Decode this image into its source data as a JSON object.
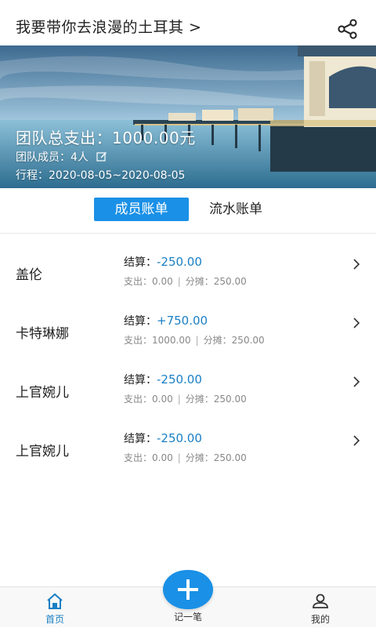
{
  "header": {
    "title": "我要带你去浪漫的土耳其 >",
    "share_icon": "share-icon"
  },
  "banner": {
    "total_label": "团队总支出：",
    "total_value": "1000.00元",
    "members_text": "团队成员：4人",
    "trip_text": "行程：2020-08-05~2020-08-05",
    "edit_icon": "edit-icon"
  },
  "tabs": {
    "active": "成员账单",
    "inactive": "流水账单"
  },
  "members": [
    {
      "name": "盖伦",
      "settle_label": "结算：",
      "settle_value": "-250.00",
      "spend": "支出：0.00",
      "share": "分摊：250.00"
    },
    {
      "name": "卡特琳娜",
      "settle_label": "结算：",
      "settle_value": "+750.00",
      "spend": "支出：1000.00",
      "share": "分摊：250.00"
    },
    {
      "name": "上官婉儿",
      "settle_label": "结算：",
      "settle_value": "-250.00",
      "spend": "支出：0.00",
      "share": "分摊：250.00"
    },
    {
      "name": "上官婉儿",
      "settle_label": "结算：",
      "settle_value": "-250.00",
      "spend": "支出：0.00",
      "share": "分摊：250.00"
    }
  ],
  "separator": "|",
  "nav": {
    "home": "首页",
    "add": "记一笔",
    "mine": "我的"
  },
  "colors": {
    "accent": "#1a90e6",
    "value": "#1a7fc4"
  }
}
